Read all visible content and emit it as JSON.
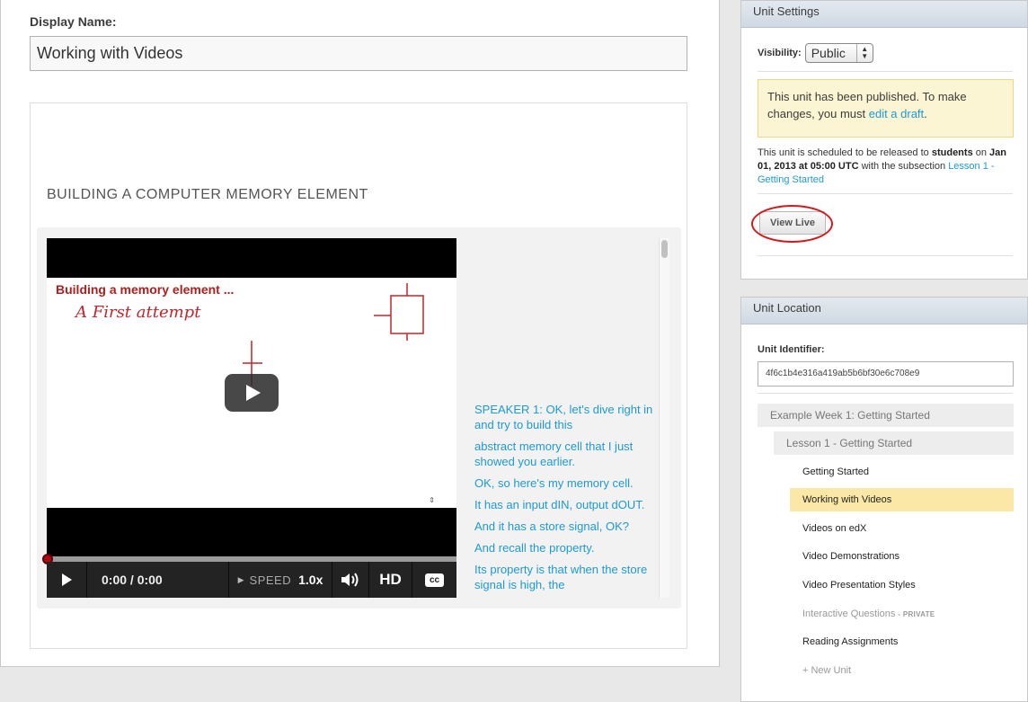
{
  "editor": {
    "display_name_label": "Display Name:",
    "display_name_value": "Working with Videos",
    "component_title": "BUILDING A COMPUTER MEMORY ELEMENT",
    "video": {
      "frame_title": "Building a memory element ...",
      "frame_note": "A  First attempt",
      "time": "0:00 / 0:00",
      "speed_label": "SPEED",
      "speed_value": "1.0x",
      "hd_label": "HD",
      "cc_label": "cc",
      "progress": 0
    },
    "transcript": [
      "SPEAKER 1: OK, let's dive right in and try to build this",
      "abstract memory cell that I just showed you earlier.",
      "OK, so here's my memory cell.",
      "It has an input dIN, output dOUT.",
      "And it has a store signal, OK?",
      "And recall the property.",
      "Its property is that when the store signal is high, the"
    ]
  },
  "unit_settings": {
    "title": "Unit Settings",
    "visibility_label": "Visibility:",
    "visibility_value": "Public",
    "warning_text": "This unit has been published. To make changes, you must ",
    "warning_link": "edit a draft",
    "warning_end": ".",
    "release_1": "This unit is scheduled to be released to ",
    "release_bold_1": "students",
    "release_2": " on ",
    "release_bold_2": "Jan 01, 2013 at 05:00 UTC",
    "release_3": " with the subsection ",
    "release_link": "Lesson 1 - Getting Started",
    "view_live": "View Live"
  },
  "unit_location": {
    "title": "Unit Location",
    "identifier_label": "Unit Identifier:",
    "identifier_value": "4f6c1b4e316a419ab5b6bf30e6c708e9",
    "section": "Example Week 1: Getting Started",
    "subsection": "Lesson 1 - Getting Started",
    "units": [
      {
        "label": "Getting Started",
        "state": "normal"
      },
      {
        "label": "Working with Videos",
        "state": "active"
      },
      {
        "label": "Videos on edX",
        "state": "normal"
      },
      {
        "label": "Video Demonstrations",
        "state": "normal"
      },
      {
        "label": "Video Presentation Styles",
        "state": "normal"
      },
      {
        "label": "Interactive Questions",
        "state": "private",
        "tag": "- PRIVATE"
      },
      {
        "label": "Reading Assignments",
        "state": "normal"
      },
      {
        "label": "+ New Unit",
        "state": "new"
      }
    ]
  },
  "colors": {
    "link": "#1d9ad6",
    "active_unit": "#fbe8a6",
    "warning_bg": "#fcf5d3",
    "highlight_ring": "#d8171b",
    "progress_knob": "#b20610"
  },
  "icons": [
    "play-icon",
    "volume-icon",
    "closed-captions-icon",
    "select-arrows-icon",
    "plus-icon"
  ]
}
